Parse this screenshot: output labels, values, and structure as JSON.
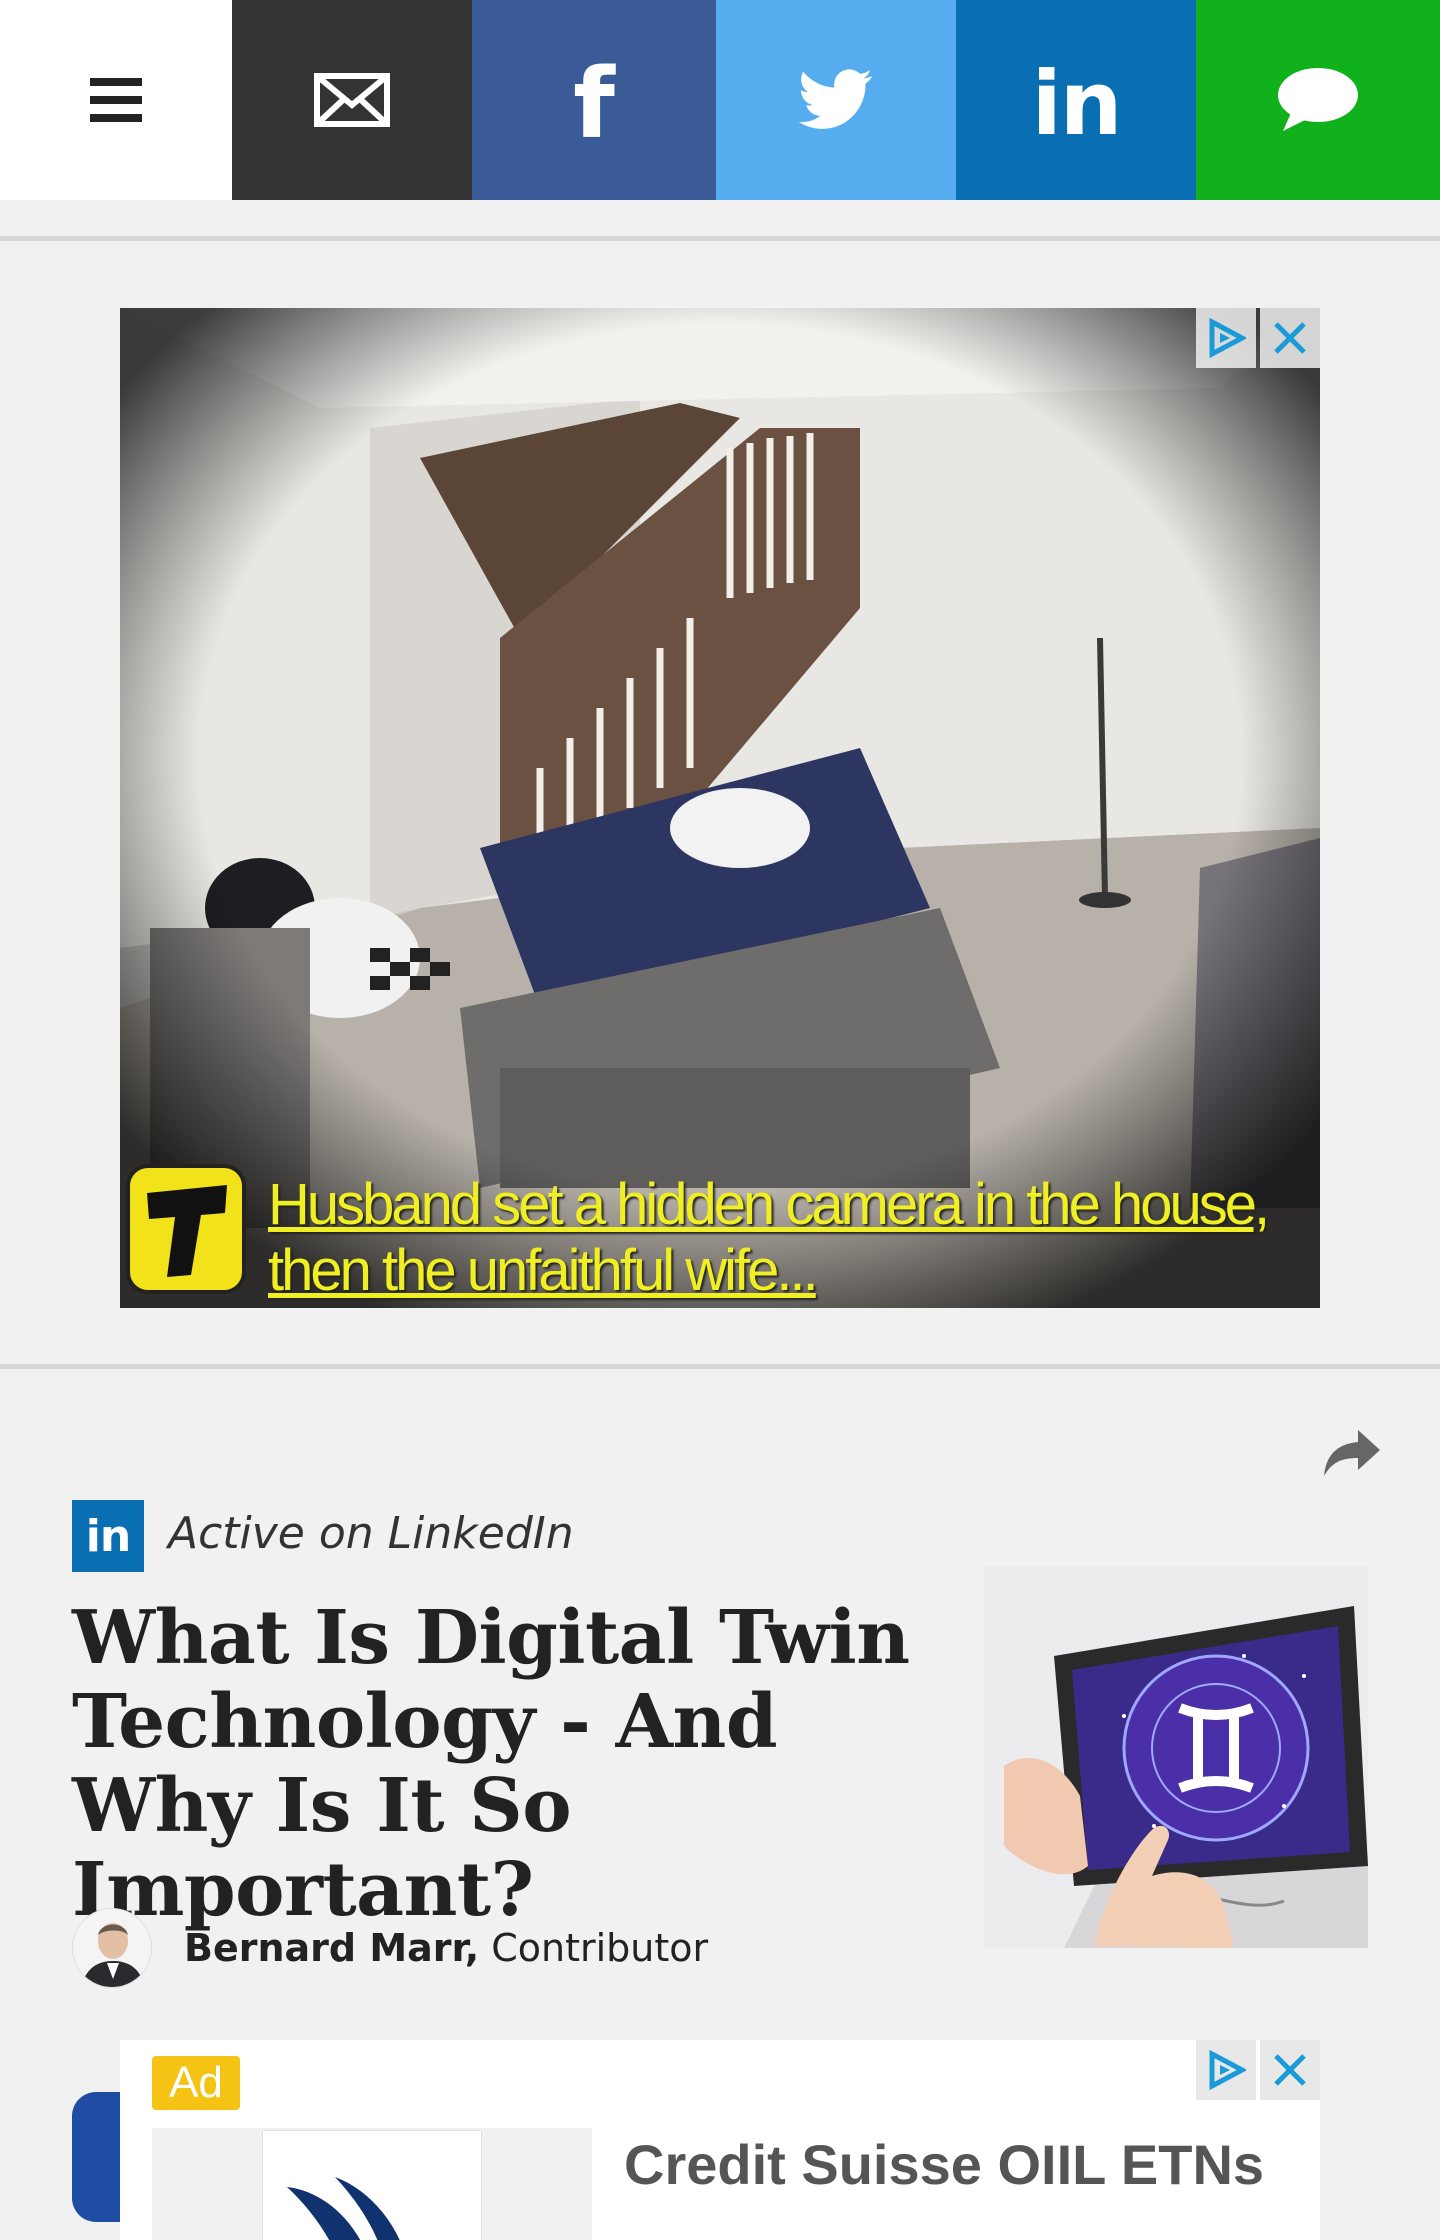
{
  "topbar": {
    "buttons": [
      {
        "name": "menu",
        "icon": "hamburger-icon",
        "color": "#ffffff"
      },
      {
        "name": "email",
        "icon": "envelope-icon",
        "color": "#333333"
      },
      {
        "name": "facebook",
        "icon": "facebook-icon",
        "glyph": "f",
        "color": "#3b5b98"
      },
      {
        "name": "twitter",
        "icon": "twitter-bird-icon",
        "color": "#55acee"
      },
      {
        "name": "linkedin",
        "icon": "linkedin-icon",
        "glyph": "in",
        "color": "#0a6fb2"
      },
      {
        "name": "sms",
        "icon": "speech-bubble-icon",
        "color": "#10b11b"
      }
    ]
  },
  "ad1": {
    "caption": "Husband set a hidden camera in the house, then the unfaithful wife...",
    "logo_letter": "T",
    "adchoices_icon": "adchoices-icon",
    "close_icon": "close-icon"
  },
  "article": {
    "badge": "in",
    "badge_label": "Active on LinkedIn",
    "headline": "What Is Digital Twin Technology - And Why Is It So Important?",
    "author": "Bernard Marr,",
    "role": " Contributor",
    "share_icon": "share-arrow-icon"
  },
  "ad2": {
    "tag": "Ad",
    "title": "Credit Suisse OIIL ETNs"
  }
}
